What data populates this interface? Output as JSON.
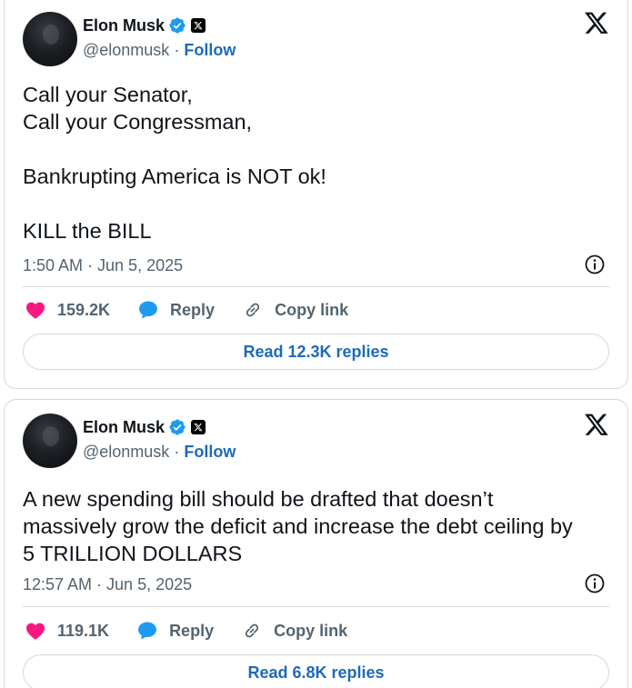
{
  "tweets": [
    {
      "author_name": "Elon Musk",
      "handle": "@elonmusk",
      "separator": "·",
      "follow_label": "Follow",
      "lines": [
        "Call your Senator,",
        "Call your Congressman,",
        "",
        "Bankrupting America is NOT ok!",
        "",
        "KILL the BILL"
      ],
      "timestamp": "1:50 AM · Jun 5, 2025",
      "likes": "159.2K",
      "reply_label": "Reply",
      "copy_label": "Copy link",
      "read_replies": "Read 12.3K replies"
    },
    {
      "author_name": "Elon Musk",
      "handle": "@elonmusk",
      "separator": "·",
      "follow_label": "Follow",
      "lines": [
        "A new spending bill should be drafted that doesn’t",
        "massively grow the deficit and increase the debt ceiling by",
        "5 TRILLION DOLLARS"
      ],
      "timestamp": "12:57 AM · Jun 5, 2025",
      "likes": "119.1K",
      "reply_label": "Reply",
      "copy_label": "Copy link",
      "read_replies": "Read 6.8K replies"
    }
  ],
  "icons": {
    "verified": "verified-badge-icon",
    "affiliate": "x-affiliate-badge-icon",
    "brand": "x-logo-icon",
    "info": "info-icon",
    "like": "heart-icon",
    "reply": "speech-bubble-icon",
    "copy": "link-icon"
  },
  "colors": {
    "like": "#f91880",
    "reply": "#1d9bf0",
    "follow": "#1d6bb8",
    "secondary_text": "#536471",
    "border": "#cfd9de"
  }
}
